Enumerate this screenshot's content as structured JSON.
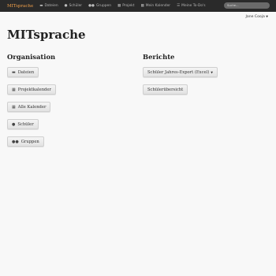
{
  "navbar": {
    "brand": "MITsprache",
    "items": [
      {
        "label": "Dateien",
        "icon": "folder-icon"
      },
      {
        "label": "Schüler",
        "icon": "user-icon"
      },
      {
        "label": "Gruppen",
        "icon": "users-icon"
      },
      {
        "label": "Projekt",
        "icon": "calendar-icon"
      },
      {
        "label": "Mein Kalender",
        "icon": "calendar-icon"
      },
      {
        "label": "Meine To-Do's",
        "icon": "list-icon"
      }
    ],
    "search_placeholder": "Suche…"
  },
  "user": {
    "name": "Jane Cooja"
  },
  "page": {
    "title": "MITsprache"
  },
  "organisation": {
    "heading": "Organisation",
    "buttons": [
      {
        "label": "Dateien",
        "icon": "folder-icon"
      },
      {
        "label": "Projektkalender",
        "icon": "calendar-icon"
      },
      {
        "label": "Alle Kalender",
        "icon": "calendar-icon"
      },
      {
        "label": "Schüler",
        "icon": "user-icon"
      },
      {
        "label": "Gruppen",
        "icon": "users-icon"
      }
    ]
  },
  "berichte": {
    "heading": "Berichte",
    "buttons": [
      {
        "label": "Schüler Jahres-Export (Excel)"
      },
      {
        "label": "Schülerübersicht"
      }
    ]
  }
}
